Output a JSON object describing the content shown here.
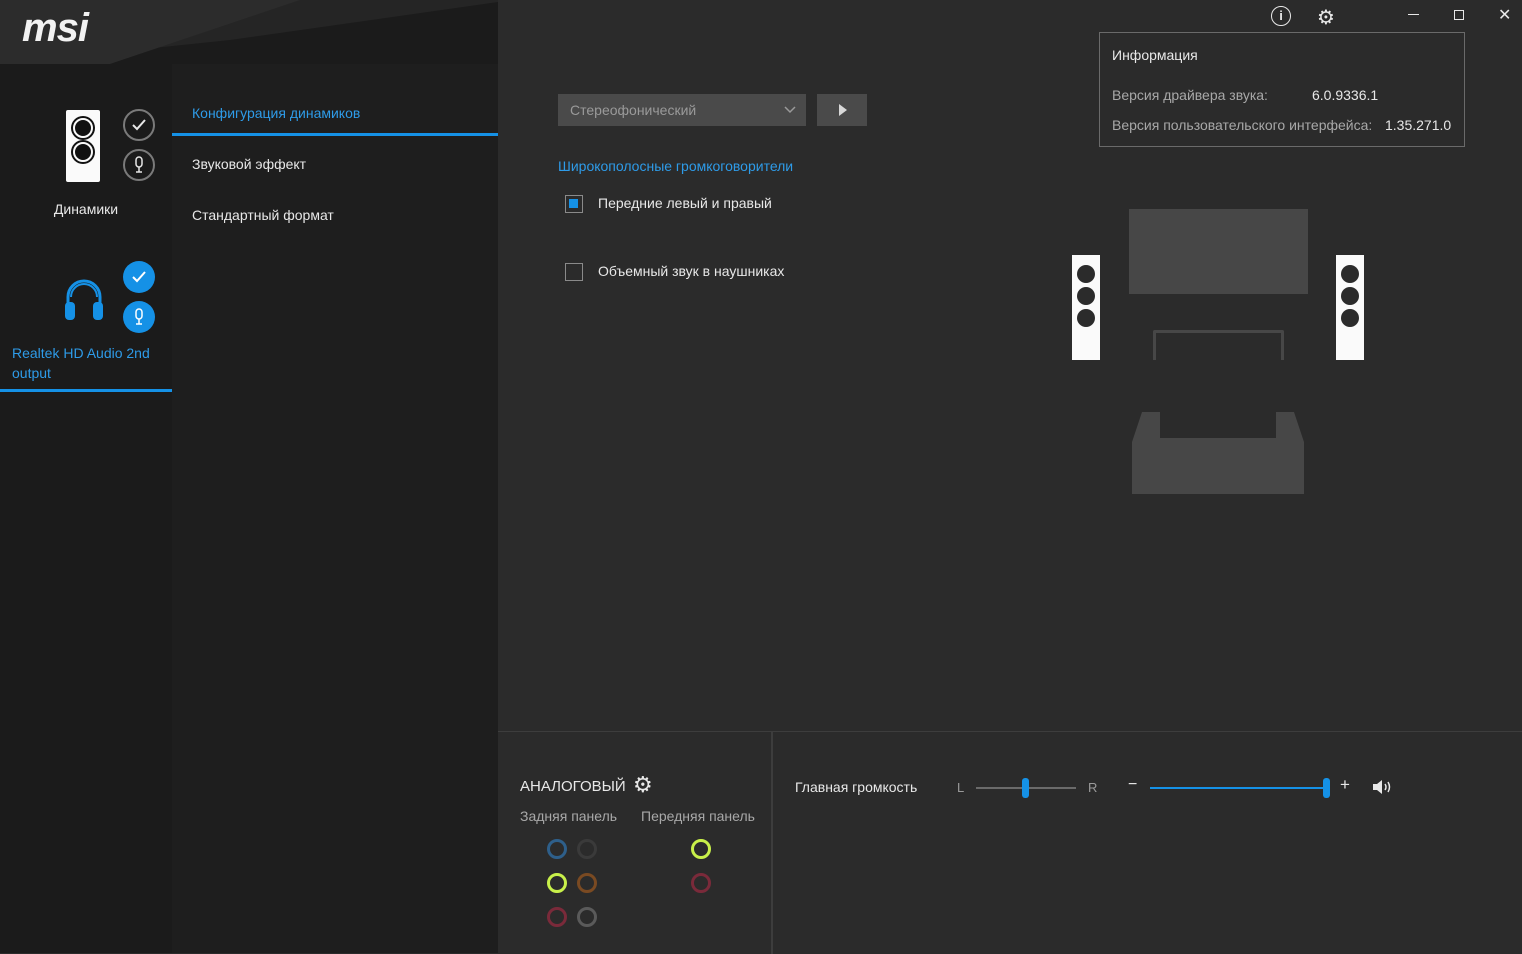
{
  "brand": "msi",
  "devices": [
    {
      "label": "Динамики",
      "icon": "speaker-icon",
      "state": "inactive"
    },
    {
      "label": "Realtek HD Audio 2nd output",
      "icon": "headphones-icon",
      "state": "selected"
    }
  ],
  "nav": {
    "items": [
      {
        "label": "Конфигурация динамиков",
        "active": true
      },
      {
        "label": "Звуковой эффект",
        "active": false
      },
      {
        "label": "Стандартный формат",
        "active": false
      }
    ]
  },
  "config": {
    "dropdown_value": "Стереофонический",
    "section_title": "Широкополосные громкоговорители",
    "checkbox_front": {
      "label": "Передние левый и правый",
      "checked": true
    },
    "checkbox_surround": {
      "label": "Объемный звук в наушниках",
      "checked": false
    }
  },
  "info": {
    "title": "Информация",
    "driver_label": "Версия драйвера звука:",
    "driver_value": "6.0.9336.1",
    "ui_label": "Версия пользовательского интерфейса:",
    "ui_value": "1.35.271.0"
  },
  "bottom": {
    "analog_title": "АНАЛОГОВЫЙ",
    "rear_panel": "Задняя панель",
    "front_panel": "Передняя панель",
    "master_volume": "Главная громкость",
    "balance_left": "L",
    "balance_right": "R",
    "minus": "−",
    "plus": "+",
    "balance_value": 0.5,
    "volume_value": 1.0
  },
  "colors": {
    "accent": "#1591e6",
    "jack_blue": "#2e5f8a",
    "jack_green": "#c8f04a",
    "jack_pink": "#7a2a3a",
    "jack_orange": "#7a4a22",
    "jack_black": "#3a3a3a",
    "jack_gray": "#5a5a5a"
  }
}
